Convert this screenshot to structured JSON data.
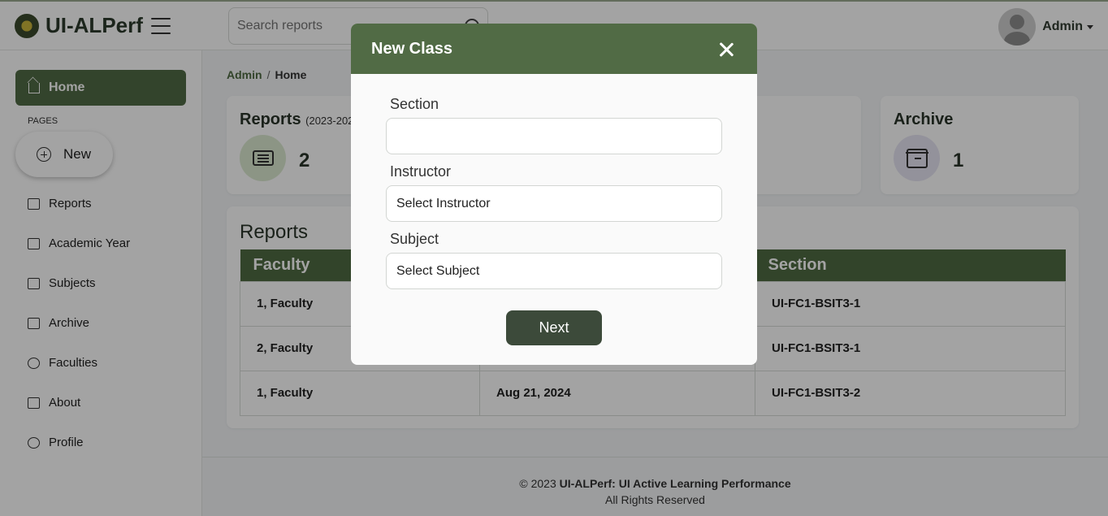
{
  "header": {
    "app_name": "UI-ALPerf",
    "search_placeholder": "Search reports",
    "user_name": "Admin"
  },
  "sidebar": {
    "home_label": "Home",
    "pages_label": "PAGES",
    "new_label": "New",
    "items": [
      {
        "label": "Reports",
        "icon": "reports-icon"
      },
      {
        "label": "Academic Year",
        "icon": "calendar-icon"
      },
      {
        "label": "Subjects",
        "icon": "subjects-icon"
      },
      {
        "label": "Archive",
        "icon": "archive-icon"
      },
      {
        "label": "Faculties",
        "icon": "faculties-icon"
      },
      {
        "label": "About",
        "icon": "about-icon"
      },
      {
        "label": "Profile",
        "icon": "profile-icon"
      }
    ]
  },
  "breadcrumb": {
    "root": "Admin",
    "separator": "/",
    "current": "Home"
  },
  "stats": {
    "reports": {
      "title": "Reports",
      "subtitle": "(2023-202",
      "value": "2",
      "circle_color": "#dbe9d1"
    },
    "archive": {
      "title": "Archive",
      "value": "1",
      "circle_color": "#e6e4f3"
    }
  },
  "reports_table": {
    "title": "Reports",
    "columns": [
      "Faculty",
      "",
      "Section"
    ],
    "rows": [
      [
        "1, Faculty",
        "",
        "UI-FC1-BSIT3-1"
      ],
      [
        "2, Faculty",
        "",
        "UI-FC1-BSIT3-1"
      ],
      [
        "1, Faculty",
        "Aug 21, 2024",
        "UI-FC1-BSIT3-2"
      ]
    ]
  },
  "footer": {
    "prefix": "© 2023 ",
    "bold": "UI-ALPerf: UI Active Learning Performance",
    "line2": "All Rights Reserved"
  },
  "modal": {
    "title": "New Class",
    "section_label": "Section",
    "section_value": "",
    "instructor_label": "Instructor",
    "instructor_value": "Select Instructor",
    "subject_label": "Subject",
    "subject_value": "Select Subject",
    "next_label": "Next"
  },
  "colors": {
    "brand": "#516b45",
    "button_dark": "#3c4a3a"
  }
}
